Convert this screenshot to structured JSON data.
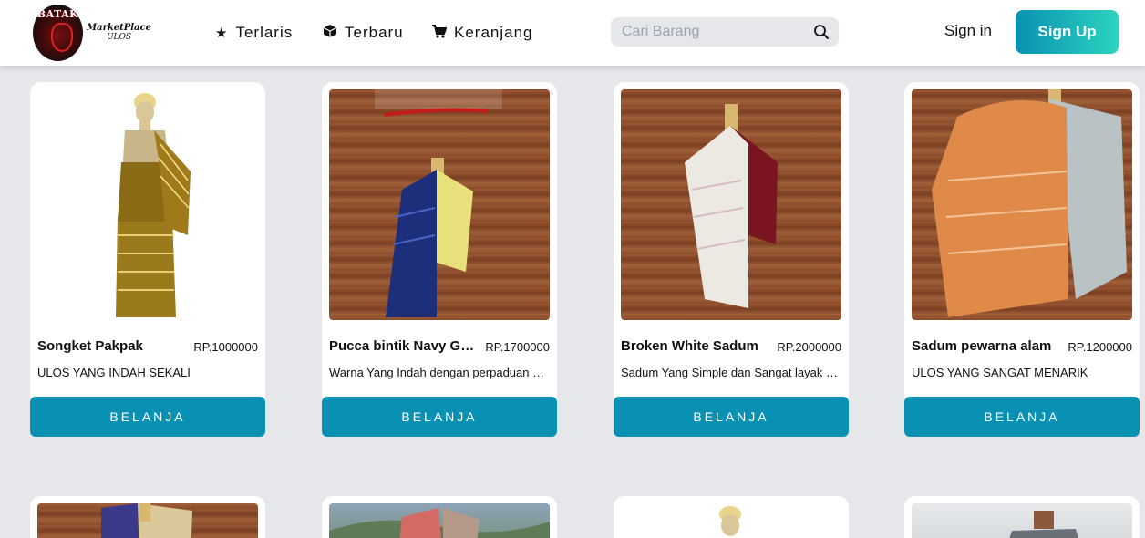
{
  "header": {
    "logo_text": "BATAK",
    "logo_line1": "MarketPlace",
    "logo_line2": "ULOS",
    "nav": [
      {
        "label": "Terlaris",
        "icon": "star-icon"
      },
      {
        "label": "Terbaru",
        "icon": "cube-icon"
      },
      {
        "label": "Keranjang",
        "icon": "cart-icon"
      }
    ],
    "search_placeholder": "Cari Barang",
    "signin": "Sign in",
    "signup": "Sign Up"
  },
  "products": [
    {
      "name": "Songket Pakpak",
      "price": "RP.1000000",
      "desc": "ULOS YANG INDAH SEKALI",
      "button": "BELANJA"
    },
    {
      "name": "Pucca bintik Navy Green",
      "price": "RP.1700000",
      "desc": "Warna Yang Indah dengan perpaduan warna",
      "button": "BELANJA"
    },
    {
      "name": "Broken White Sadum",
      "price": "RP.2000000",
      "desc": "Sadum Yang Simple dan Sangat layak dipakai",
      "button": "BELANJA"
    },
    {
      "name": "Sadum pewarna alam",
      "price": "RP.1200000",
      "desc": "ULOS YANG SANGAT MENARIK",
      "button": "BELANJA"
    }
  ],
  "colors": {
    "accent": "#0891b2",
    "signup_gradient_end": "#2dd4bf",
    "background": "#e5e7eb"
  }
}
